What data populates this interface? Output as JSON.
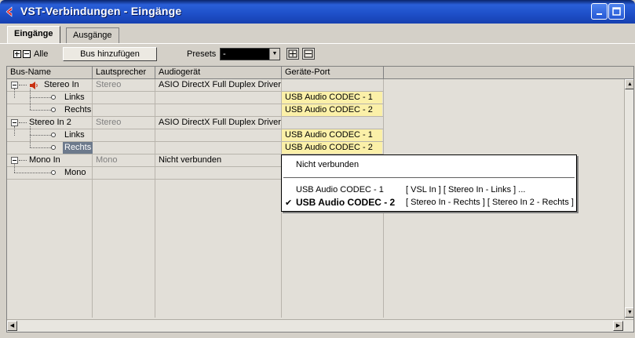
{
  "window": {
    "title": "VST-Verbindungen - Eingänge"
  },
  "tabs": [
    {
      "label": "Eingänge",
      "active": true
    },
    {
      "label": "Ausgänge",
      "active": false
    }
  ],
  "toolbar": {
    "alle_label": "Alle",
    "add_bus_label": "Bus hinzufügen",
    "presets_label": "Presets",
    "presets_value": "-"
  },
  "table": {
    "columns": [
      "Bus-Name",
      "Lautsprecher",
      "Audiogerät",
      "Geräte-Port"
    ],
    "rows": [
      {
        "name": "Stereo In",
        "speaker": "Stereo",
        "device": "ASIO DirectX Full Duplex Driver",
        "port": ""
      },
      {
        "name": "Links",
        "speaker": "",
        "device": "",
        "port": "USB Audio CODEC  - 1"
      },
      {
        "name": "Rechts",
        "speaker": "",
        "device": "",
        "port": "USB Audio CODEC  - 2"
      },
      {
        "name": "Stereo In 2",
        "speaker": "Stereo",
        "device": "ASIO DirectX Full Duplex Driver",
        "port": ""
      },
      {
        "name": "Links",
        "speaker": "",
        "device": "",
        "port": "USB Audio CODEC  - 1"
      },
      {
        "name": "Rechts",
        "speaker": "",
        "device": "",
        "port": "USB Audio CODEC  - 2"
      },
      {
        "name": "Mono In",
        "speaker": "Mono",
        "device": "Nicht verbunden",
        "port": ""
      },
      {
        "name": "Mono",
        "speaker": "",
        "device": "",
        "port": ""
      }
    ]
  },
  "menu": {
    "not_connected": "Nicht verbunden",
    "items": [
      {
        "label": "USB Audio CODEC  - 1",
        "info": "[ VSL In ] [ Stereo In - Links ] ...",
        "checked": false
      },
      {
        "label": "USB Audio CODEC  - 2",
        "info": "[ Stereo In - Rechts ] [ Stereo In 2 - Rechts ]",
        "checked": true
      }
    ],
    "checkmark": "✔"
  },
  "colors": {
    "title_bar": "#1e4fc8",
    "port_highlight": "#fbf0a8",
    "selected_row": "#6d7a8c"
  }
}
